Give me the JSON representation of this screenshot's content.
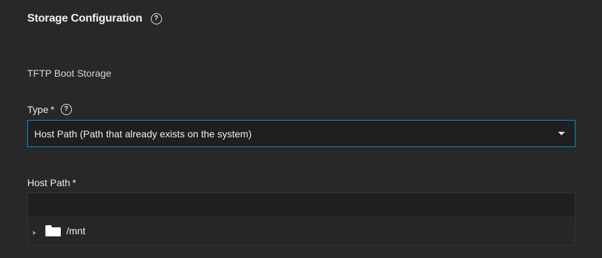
{
  "section": {
    "title": "Storage Configuration",
    "help_icon": "question-circle-icon"
  },
  "subsection": {
    "label": "TFTP Boot Storage"
  },
  "type_field": {
    "label": "Type",
    "required_marker": "*",
    "help_icon": "question-circle-icon",
    "selected_value": "Host Path (Path that already exists on the system)",
    "arrow_icon": "caret-down-icon"
  },
  "host_path_field": {
    "label": "Host Path",
    "required_marker": "*",
    "value": "",
    "tree": {
      "nodes": [
        {
          "label": "/mnt",
          "icon": "folder-icon",
          "toggle_icon": "caret-right-icon",
          "expanded": false
        }
      ]
    }
  },
  "colors": {
    "background": "#282828",
    "input_background": "#1f1f1f",
    "focus_border": "#0095d5",
    "text": "#f0f0f0"
  }
}
